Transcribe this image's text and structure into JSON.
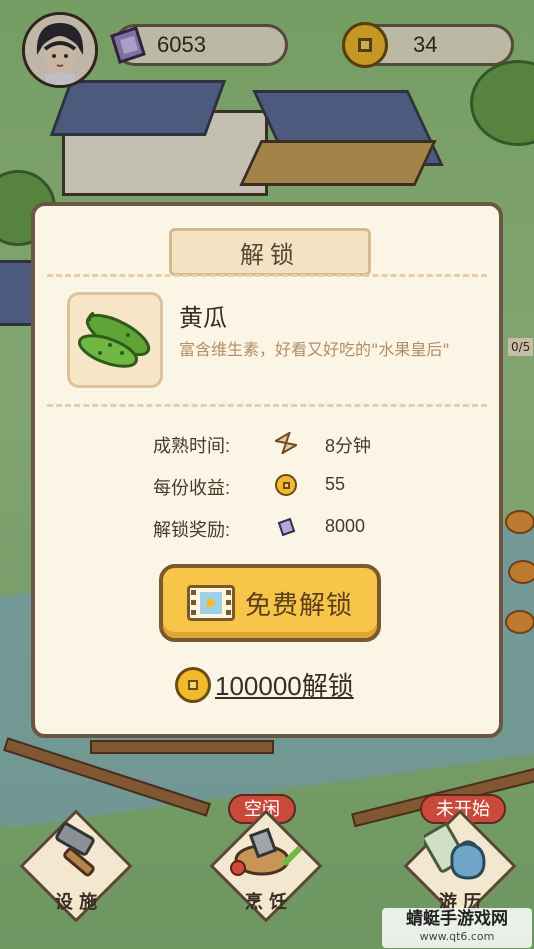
{
  "hud": {
    "gems": "6053",
    "coins": "34"
  },
  "side": {
    "count": "0/5"
  },
  "dialog": {
    "title": "解锁",
    "item": {
      "name": "黄瓜",
      "description": "富含维生素，好看又好吃的\"水果皇后\""
    },
    "rows": [
      {
        "label": "成熟时间:",
        "icon": "hourglass-icon",
        "value": "8分钟"
      },
      {
        "label": "每份收益:",
        "icon": "coin-icon",
        "value": "55"
      },
      {
        "label": "解锁奖励:",
        "icon": "gem-icon",
        "value": "8000"
      }
    ],
    "free_unlock_label": "免费解锁",
    "coin_unlock_label": "100000解锁"
  },
  "bottom": {
    "facility_label": "设 施",
    "cooking_label": "烹 饪",
    "travel_label": "游 历",
    "cooking_status": "空闲",
    "travel_status": "未开始"
  },
  "watermark": {
    "title": "蜻蜓手游戏网",
    "url": "www.qt6.com"
  },
  "colors": {
    "dialog_bg": "#fbf5e6",
    "button_yellow": "#f6c54a",
    "status_red": "#c94a3a",
    "coin_gold": "#f2b92d"
  }
}
